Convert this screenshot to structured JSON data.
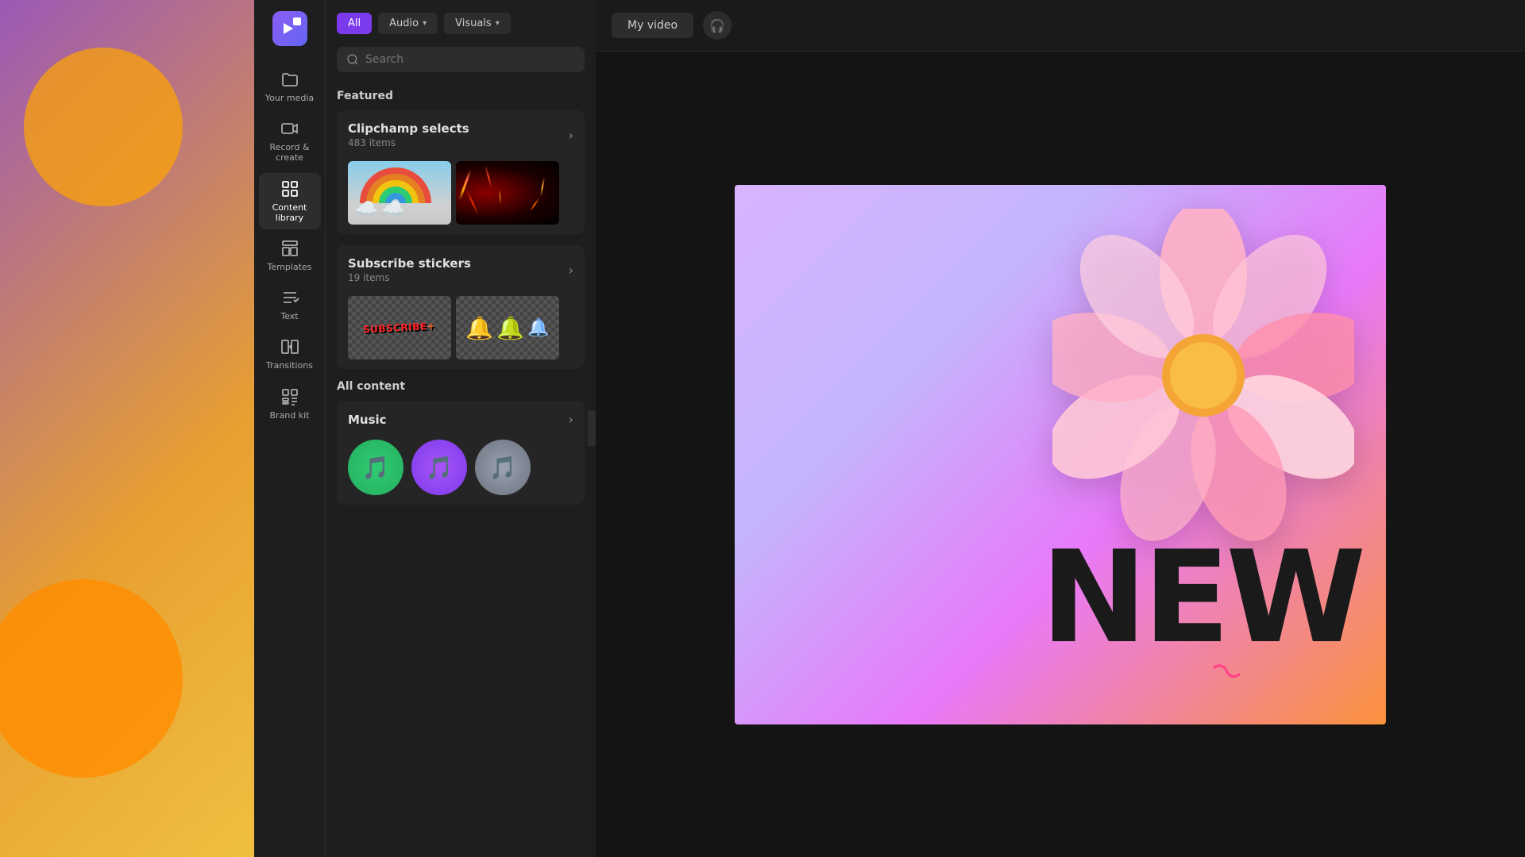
{
  "app": {
    "title": "Clipchamp"
  },
  "sidebar": {
    "items": [
      {
        "id": "your-media",
        "label": "Your media",
        "icon": "folder"
      },
      {
        "id": "record-create",
        "label": "Record &\ncreate",
        "icon": "video"
      },
      {
        "id": "content-library",
        "label": "Content library",
        "icon": "grid",
        "active": true
      },
      {
        "id": "templates",
        "label": "Templates",
        "icon": "template"
      },
      {
        "id": "text",
        "label": "Text",
        "icon": "text"
      },
      {
        "id": "transitions",
        "label": "Transitions",
        "icon": "transitions"
      },
      {
        "id": "brand-kit",
        "label": "Brand kit",
        "icon": "brand"
      }
    ]
  },
  "filters": {
    "all_label": "All",
    "audio_label": "Audio",
    "visuals_label": "Visuals"
  },
  "search": {
    "placeholder": "Search"
  },
  "featured": {
    "title": "Featured",
    "clipchamp_selects": {
      "title": "Clipchamp selects",
      "subtitle": "483 items"
    },
    "subscribe_stickers": {
      "title": "Subscribe stickers",
      "subtitle": "19 items"
    }
  },
  "all_content": {
    "title": "All content",
    "music": {
      "title": "Music"
    }
  },
  "header": {
    "video_title": "My video",
    "icon": "🎧"
  }
}
